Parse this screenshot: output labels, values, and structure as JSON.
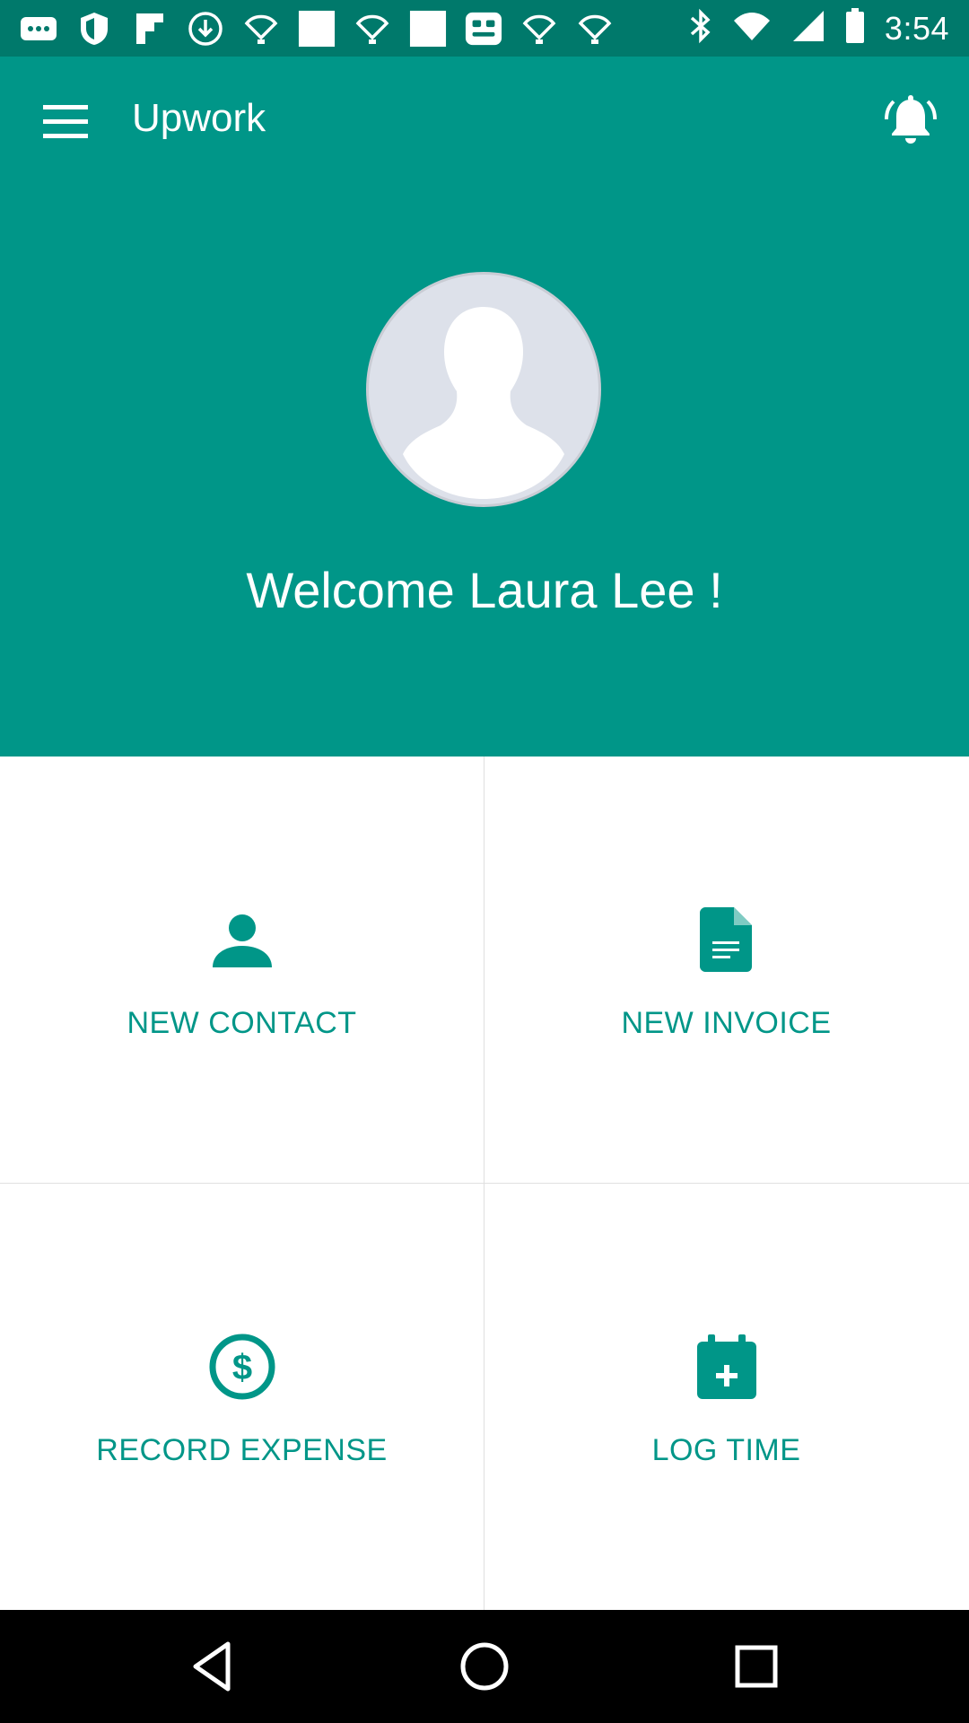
{
  "status_bar": {
    "time": "3:54",
    "left_icons": [
      "more-notifications-icon",
      "shield-icon",
      "flipboard-icon",
      "download-icon",
      "location-icon",
      "image-icon",
      "location-icon",
      "image-icon",
      "game-icon",
      "location-icon",
      "location-icon"
    ],
    "right_icons": [
      "bluetooth-icon",
      "wifi-icon",
      "signal-icon",
      "battery-icon"
    ]
  },
  "toolbar": {
    "title": "Upwork",
    "menu_icon": "menu-icon",
    "notification_icon": "bell-icon"
  },
  "profile": {
    "welcome_text": "Welcome Laura Lee !"
  },
  "tiles": [
    {
      "label": "NEW CONTACT",
      "icon": "person-icon"
    },
    {
      "label": "NEW INVOICE",
      "icon": "document-icon"
    },
    {
      "label": "RECORD EXPENSE",
      "icon": "dollar-icon"
    },
    {
      "label": "LOG TIME",
      "icon": "calendar-add-icon"
    }
  ],
  "nav_bar": {
    "buttons": [
      "back-icon",
      "home-icon",
      "recents-icon"
    ]
  },
  "colors": {
    "status_bar": "#00796b",
    "header": "#009688",
    "accent": "#009688",
    "nav_bar": "#000000"
  }
}
